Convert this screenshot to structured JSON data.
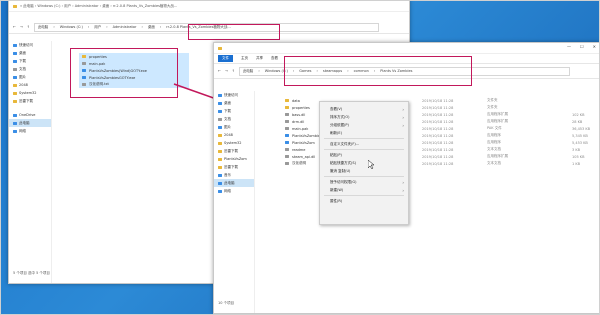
{
  "win1": {
    "title": "« 此电脑 › Windows (C:) › 用户 › Administrator › 桌面 › rr.2.0.8 Plants_Vs_Zombies植物大战...",
    "address": [
      "此电脑",
      "Windows (C:)",
      "用户",
      "Administrator",
      "桌面",
      "rr.2.0.8 Plants_Vs_Zombies植物大战..."
    ],
    "nav": [
      "快速访问",
      "桌面",
      "下载",
      "文档",
      "图片",
      "2048",
      "System32",
      "迅雷下载",
      "此电脑",
      "OneDrive",
      "此电脑",
      "网络"
    ],
    "files": [
      "properties",
      "main.pak",
      "PlantsVsZombies(Wind)GOTY.exe",
      "PlantsVsZombiesGOTY.exe",
      "汉化说明.txt"
    ],
    "status": "5 个项目  选中 5 个项目"
  },
  "win2": {
    "tabs": [
      "文件",
      "主页",
      "共享",
      "查看"
    ],
    "address": [
      "此电脑",
      "Windows (C:)",
      "Games",
      "steamapps",
      "common",
      "Plants Vs Zombies"
    ],
    "nav": [
      "快速访问",
      "桌面",
      "下载",
      "文档",
      "图片",
      "2048",
      "System32",
      "迅雷下载",
      "PlantsVsZom",
      "迅雷下载",
      "音乐",
      "此电脑",
      "网络"
    ],
    "files": [
      {
        "name": "data",
        "date": "2019/10/18 11:28",
        "type": "文件夹",
        "size": ""
      },
      {
        "name": "properties",
        "date": "2019/10/18 11:28",
        "type": "文件夹",
        "size": ""
      },
      {
        "name": "bass.dll",
        "date": "2019/10/18 11:28",
        "type": "应用程序扩展",
        "size": "102 KB"
      },
      {
        "name": "drm.dll",
        "date": "2019/10/18 11:28",
        "type": "应用程序扩展",
        "size": "28 KB"
      },
      {
        "name": "main.pak",
        "date": "2019/10/18 11:28",
        "type": "PAK 文件",
        "size": "36,453 KB"
      },
      {
        "name": "PlantsVsZombies",
        "date": "2019/10/18 11:28",
        "type": "应用程序",
        "size": "5,345 KB"
      },
      {
        "name": "PlantsVsZom",
        "date": "2019/10/18 11:28",
        "type": "应用程序",
        "size": "5,453 KB"
      },
      {
        "name": "readme",
        "date": "2019/10/18 11:28",
        "type": "文本文档",
        "size": "3 KB"
      },
      {
        "name": "steam_api.dll",
        "date": "2019/10/18 11:28",
        "type": "应用程序扩展",
        "size": "105 KB"
      },
      {
        "name": "汉化说明",
        "date": "2019/10/18 11:28",
        "type": "文本文档",
        "size": "1 KB"
      }
    ],
    "status": "10 个项目"
  },
  "context_menu": {
    "items": [
      "查看(V)",
      "排序方式(O)",
      "分组依据(P)",
      "刷新(E)",
      "---",
      "自定义文件夹(F)...",
      "---",
      "粘贴(P)",
      "粘贴快捷方式(S)",
      "撤消 复制(U)",
      "---",
      "授予访问权限(G)",
      "新建(W)",
      "---",
      "属性(R)"
    ],
    "submenu": [
      true,
      true,
      true,
      false,
      false,
      false,
      false,
      false,
      false,
      false,
      false,
      true,
      true,
      false,
      false
    ]
  },
  "colors": {
    "highlight": "#c2185b",
    "accent": "#1a6fd1"
  }
}
